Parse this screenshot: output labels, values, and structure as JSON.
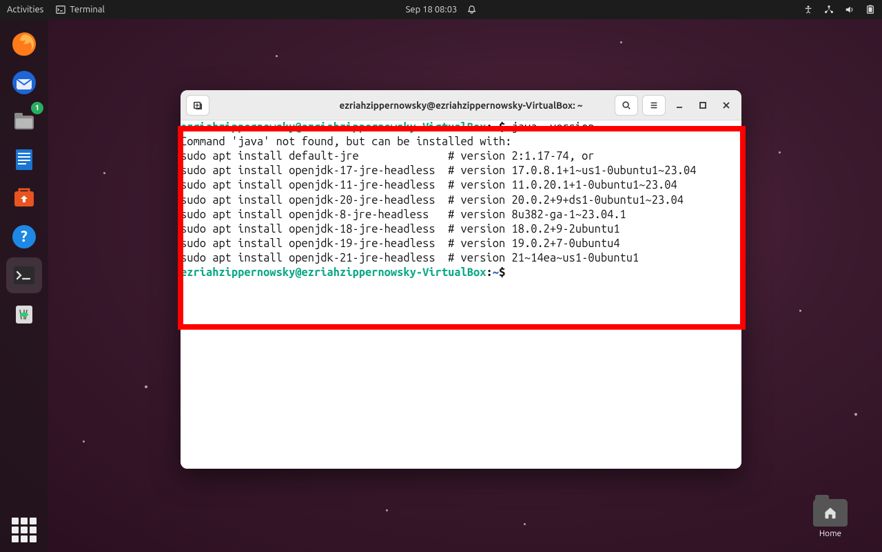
{
  "topbar": {
    "activities": "Activities",
    "app_name": "Terminal",
    "datetime": "Sep 18  08:03"
  },
  "dock": {
    "files_badge": "1"
  },
  "desktop": {
    "home_label": "Home"
  },
  "window": {
    "title": "ezriahzippernowsky@ezriahzippernowsky-VirtualBox: ~"
  },
  "terminal": {
    "prompt_user_host": "ezriahzippernowsky@ezriahzippernowsky-VirtualBox",
    "prompt_sep": ":",
    "prompt_path": "~",
    "prompt_char": "$ ",
    "cmd1": "java -version",
    "out_lines": [
      "Command 'java' not found, but can be installed with:",
      "sudo apt install default-jre              # version 2:1.17-74, or",
      "sudo apt install openjdk-17-jre-headless  # version 17.0.8.1+1~us1-0ubuntu1~23.04",
      "sudo apt install openjdk-11-jre-headless  # version 11.0.20.1+1-0ubuntu1~23.04",
      "sudo apt install openjdk-20-jre-headless  # version 20.0.2+9+ds1-0ubuntu1~23.04",
      "sudo apt install openjdk-8-jre-headless   # version 8u382-ga-1~23.04.1",
      "sudo apt install openjdk-18-jre-headless  # version 18.0.2+9-2ubuntu1",
      "sudo apt install openjdk-19-jre-headless  # version 19.0.2+7-0ubuntu4",
      "sudo apt install openjdk-21-jre-headless  # version 21~14ea~us1-0ubuntu1"
    ]
  }
}
